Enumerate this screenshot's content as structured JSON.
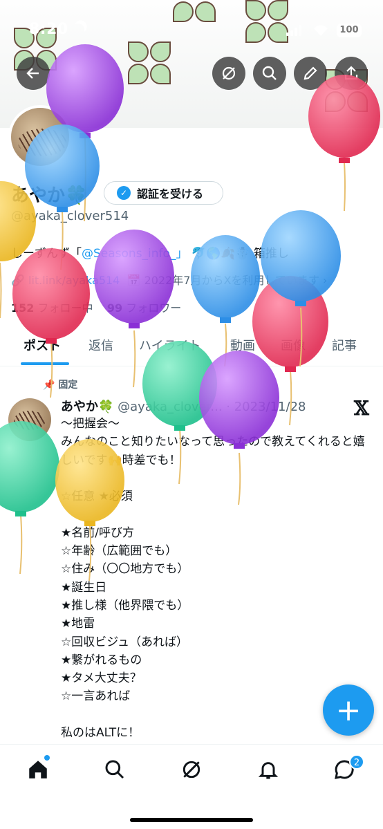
{
  "status_bar": {
    "time": "8:20",
    "battery": "100"
  },
  "profile": {
    "name": "あやか",
    "leaf": "🍀",
    "verify_label": "認証を受ける",
    "handle": "@ayaka_clover514",
    "bio_prefix": "しーずんず「",
    "bio_mention": "@Seasons_info_」",
    "bio_suffix": " 🐬🌎🍂☃️ 箱推し",
    "link": "lit.link/ayaka514",
    "joined": "2022年7月からXを利用しています",
    "following_count": "152",
    "following_label": "フォロー中",
    "followers_count": "99",
    "followers_label": "フォロワー"
  },
  "tabs": [
    {
      "label": "ポスト"
    },
    {
      "label": "返信"
    },
    {
      "label": "ハイライト"
    },
    {
      "label": "動画"
    },
    {
      "label": "画像"
    },
    {
      "label": "記事"
    }
  ],
  "post": {
    "pinned_label": "固定",
    "author": "あやか🍀",
    "handle_date": "@ayaka_clover... · 2023/11/28",
    "x_logo": "𝕏",
    "text": "〜把握会〜\nみんなのこと知りたいなって思ったので教えてくれると嬉しいです🙌時差でも！\n\n☆任意 ★必須\n\n★名前/呼び方\n☆年齢（広範囲でも）\n☆住み（〇〇地方でも）\n★誕生日\n★推し様（他界隈でも）\n★地雷\n☆回収ビジュ（あれば）\n★繋がれるもの\n★タメ大丈夫？\n☆一言あれば\n\n私のはALTに！"
  },
  "fab": {
    "label": "+"
  },
  "nav": {
    "messages_badge": "2"
  },
  "colors": {
    "accent": "#1d9bf0",
    "purple": "#a047e0",
    "pink": "#f0456e",
    "blue": "#48aaf2",
    "green": "#38d6a4",
    "yellow": "#f5c842"
  }
}
